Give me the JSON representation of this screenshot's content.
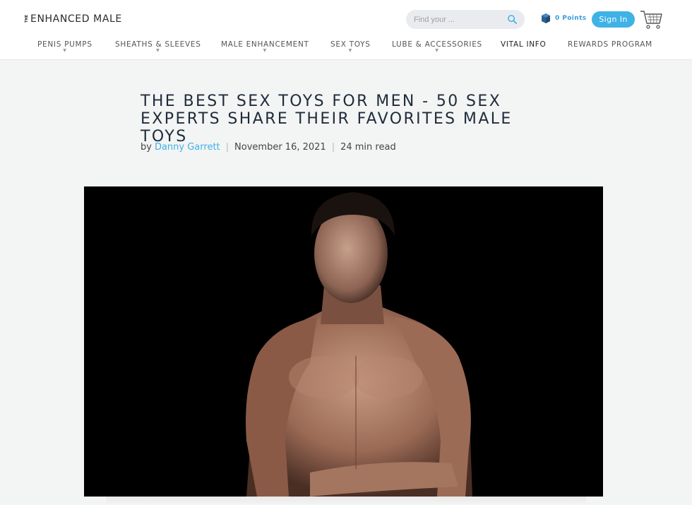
{
  "header": {
    "logo_small": "THE",
    "logo_main": "ENHANCED MALE",
    "search_placeholder": "Find your ...",
    "points_label": "0 Points",
    "signin_label": "Sign In"
  },
  "nav": {
    "items": [
      {
        "label": "PENIS PUMPS",
        "has_dropdown": true
      },
      {
        "label": "SHEATHS & SLEEVES",
        "has_dropdown": true
      },
      {
        "label": "MALE ENHANCEMENT",
        "has_dropdown": true
      },
      {
        "label": "SEX TOYS",
        "has_dropdown": true
      },
      {
        "label": "LUBE & ACCESSORIES",
        "has_dropdown": true
      },
      {
        "label": "VITAL INFO",
        "has_dropdown": false
      },
      {
        "label": "REWARDS PROGRAM",
        "has_dropdown": false
      }
    ]
  },
  "article": {
    "title_line1": "THE BEST SEX TOYS FOR MEN - 50 SEX",
    "title_line2": "EXPERTS SHARE THEIR FAVORITES MALE TOYS",
    "by": "by",
    "author": "Danny Garrett",
    "date": "November 16, 2021",
    "read_time": "24 min read"
  },
  "colors": {
    "accent": "#3fb2e6",
    "title": "#1f2b3a",
    "background": "#f3f4f4"
  }
}
